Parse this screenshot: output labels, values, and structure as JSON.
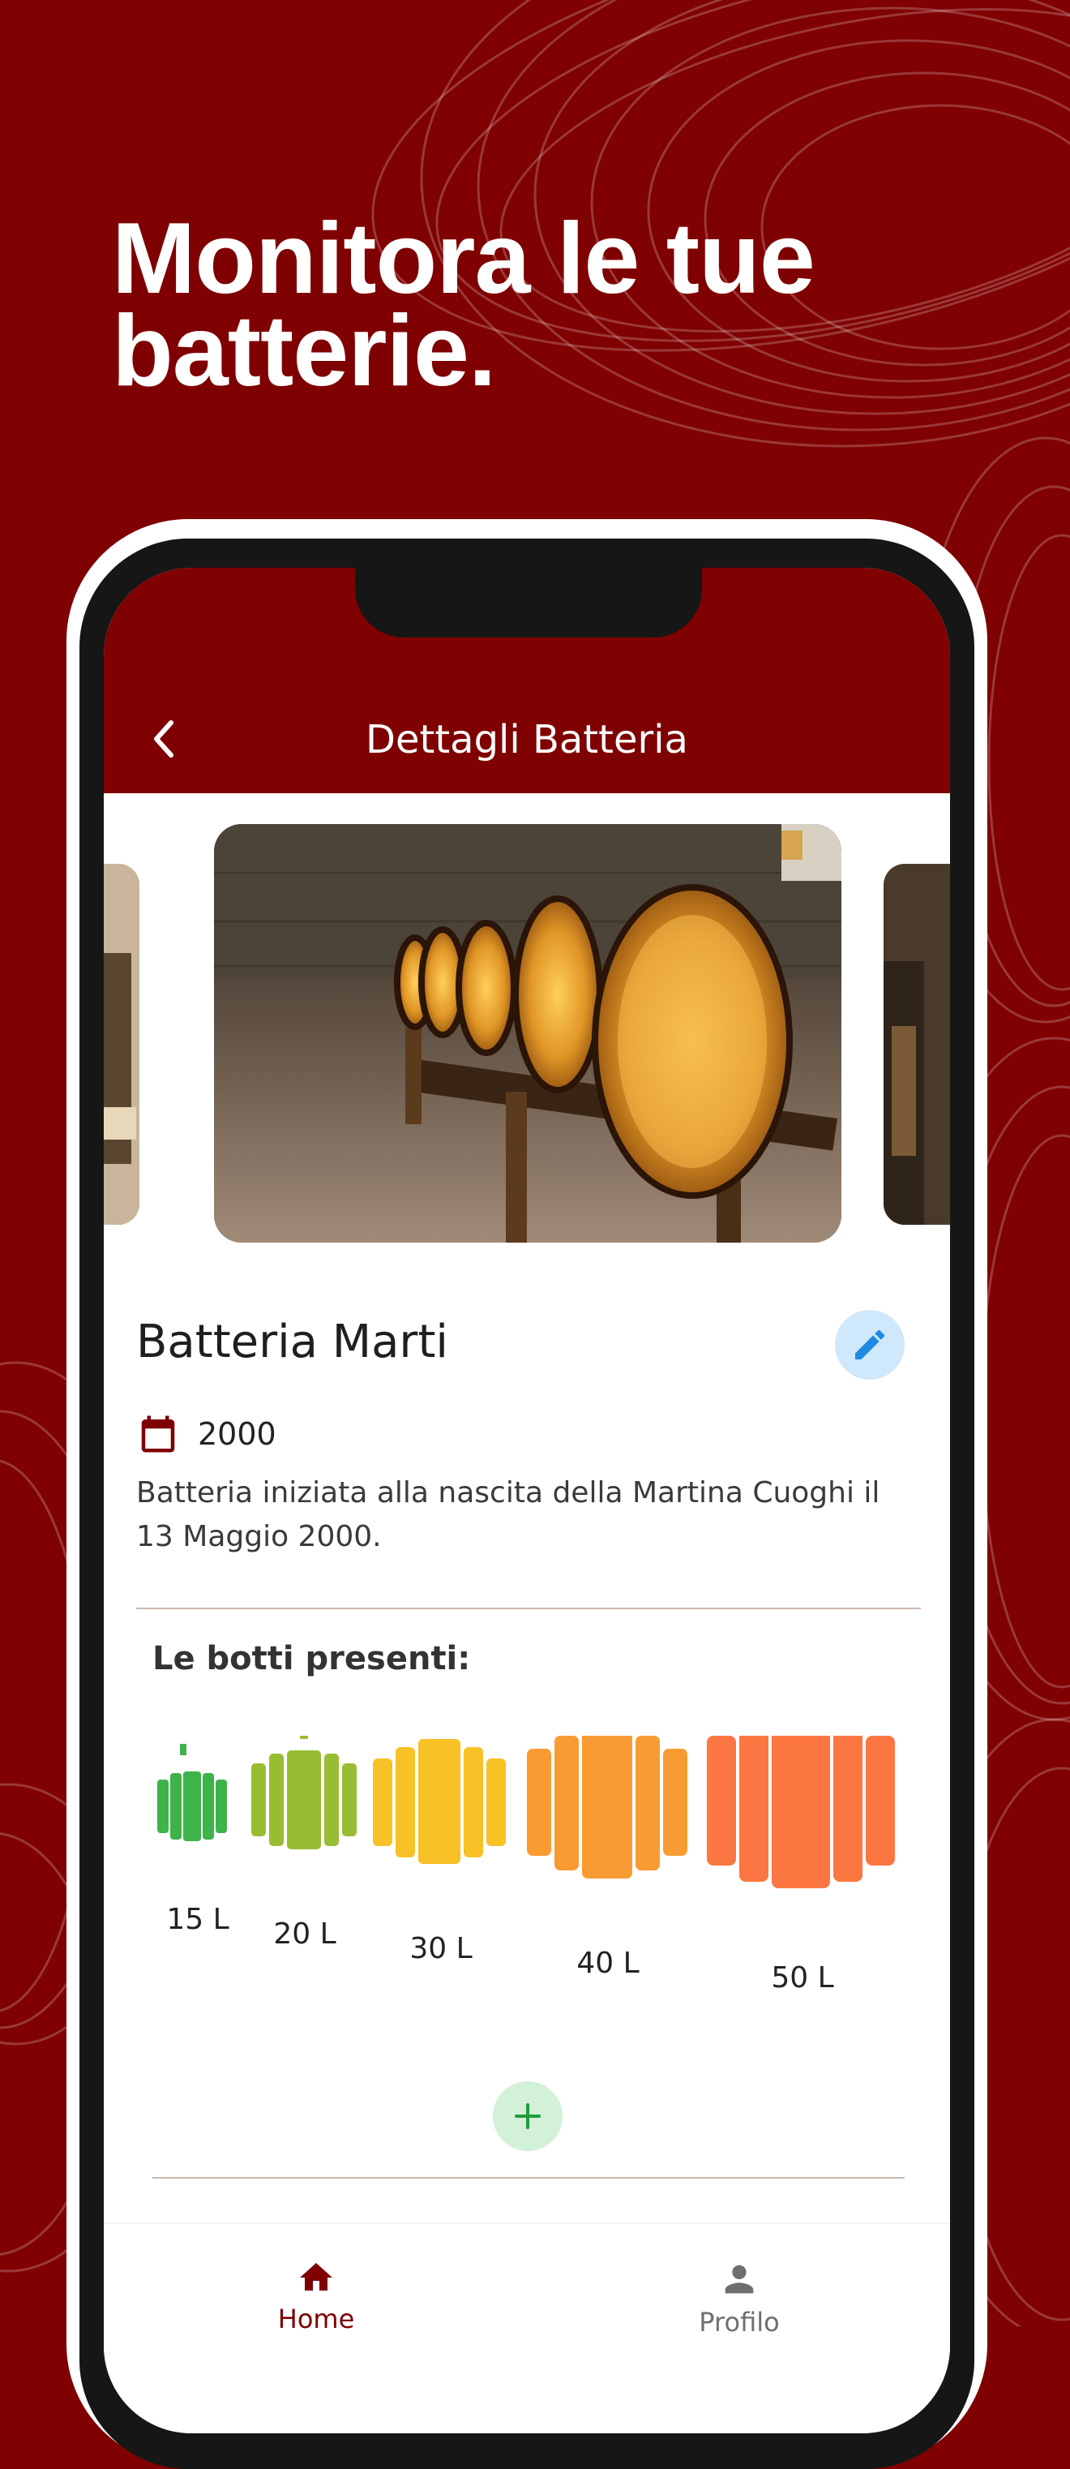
{
  "promo": {
    "headline_line1": "Monitora le tue",
    "headline_line2": "batterie."
  },
  "app_bar": {
    "title": "Dettagli Batteria",
    "back_icon": "chevron-left-icon"
  },
  "battery": {
    "name": "Batteria Marti",
    "year": "2000",
    "description": "Batteria iniziata alla nascita della Martina Cuoghi il 13 Maggio 2000.",
    "edit_icon": "pencil-icon",
    "calendar_icon": "calendar-icon"
  },
  "barrels_section": {
    "title": "Le botti presenti:",
    "barrels": [
      {
        "label": "15 L",
        "color": "#3db34a"
      },
      {
        "label": "20 L",
        "color": "#98bd32"
      },
      {
        "label": "30 L",
        "color": "#f8c125"
      },
      {
        "label": "40 L",
        "color": "#f99b33"
      },
      {
        "label": "50 L",
        "color": "#fc7642"
      }
    ],
    "add_icon": "plus-icon"
  },
  "bottom_nav": {
    "items": [
      {
        "label": "Home",
        "icon": "home-icon",
        "active": true
      },
      {
        "label": "Profilo",
        "icon": "person-icon",
        "active": false
      }
    ]
  },
  "colors": {
    "brand": "#7f0101",
    "edit_button_bg": "#cfe8fb",
    "edit_icon": "#1e88e5",
    "add_button_bg": "#d3f0d8",
    "add_icon": "#1f9d3a"
  }
}
